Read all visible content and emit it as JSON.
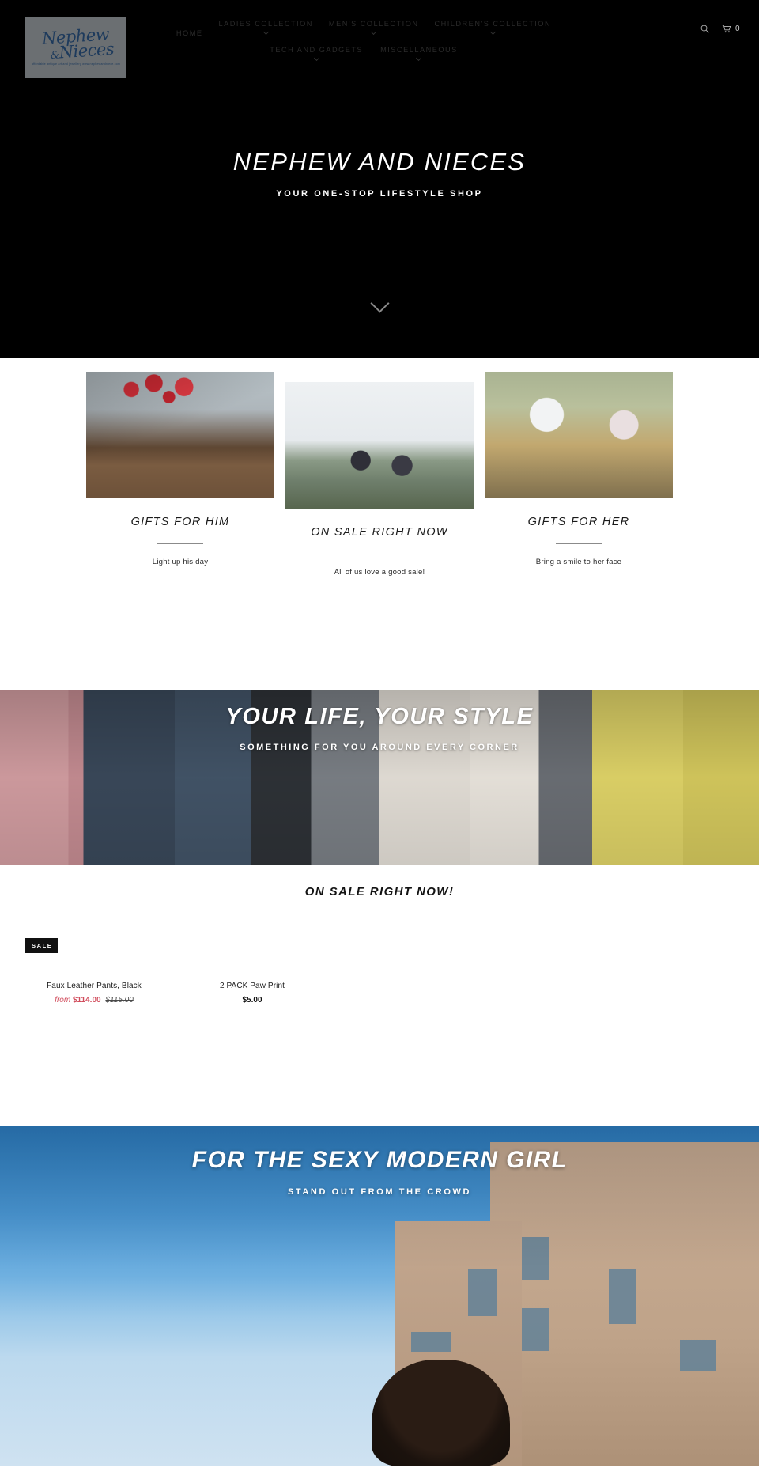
{
  "header": {
    "logo": {
      "line1": "Nephew",
      "amp": "&",
      "line2": "Nieces",
      "tagline": "affordable antique art and jewellery www.nephewandniece.com",
      "alt": "Nephew and Nieces logo"
    },
    "nav_row1": [
      {
        "label": "HOME",
        "has_dropdown": false
      },
      {
        "label": "LADIES COLLECTION",
        "has_dropdown": true
      },
      {
        "label": "MEN'S COLLECTION",
        "has_dropdown": true
      },
      {
        "label": "CHILDREN'S COLLECTION",
        "has_dropdown": true
      }
    ],
    "nav_row2": [
      {
        "label": "TECH AND GADGETS",
        "has_dropdown": true
      },
      {
        "label": "MISCELLANEOUS",
        "has_dropdown": true
      }
    ],
    "search_icon": "search-icon",
    "cart_icon": "shopping-cart-icon",
    "cart_count": "0"
  },
  "hero": {
    "title": "NEPHEW AND NIECES",
    "subtitle": "YOUR ONE-STOP LIFESTYLE SHOP",
    "scroll_icon": "chevron-down-icon",
    "background_color": "#000000"
  },
  "cards": [
    {
      "title": "GIFTS FOR HIM",
      "description": "Light up his day",
      "image_alt": "Couple embracing with red heart balloons"
    },
    {
      "title": "ON SALE RIGHT NOW",
      "description": "All of us love a good sale!",
      "image_alt": "Two people with arms raised on a mountain viewpoint"
    },
    {
      "title": "GIFTS FOR HER",
      "description": "Bring a smile to her face",
      "image_alt": "Man hiding flowers behind his back facing a woman"
    }
  ],
  "banner_lifestyle": {
    "title": "YOUR LIFE, YOUR STYLE",
    "subtitle": "SOMETHING FOR YOU AROUND EVERY CORNER",
    "image_alt": "Row of people in assorted shirts"
  },
  "sale_section": {
    "heading": "ON SALE RIGHT NOW!",
    "products": [
      {
        "badge": "SALE",
        "title": "Faux Leather Pants, Black",
        "price_from": "from",
        "price_sale": "$114.00",
        "price_was": "$115.00"
      },
      {
        "badge": null,
        "title": "2 PACK Paw Print",
        "price_plain": "$5.00"
      }
    ]
  },
  "banner_girl": {
    "title": "FOR THE SEXY MODERN GIRL",
    "subtitle": "STAND OUT FROM THE CROWD",
    "image_alt": "Woman outdoors against a blue sky and building"
  },
  "colors": {
    "background_dark": "#000000",
    "accent_sale": "#d14c5c",
    "text_dark": "#1a1a1a",
    "rule": "#8b8b8b"
  }
}
